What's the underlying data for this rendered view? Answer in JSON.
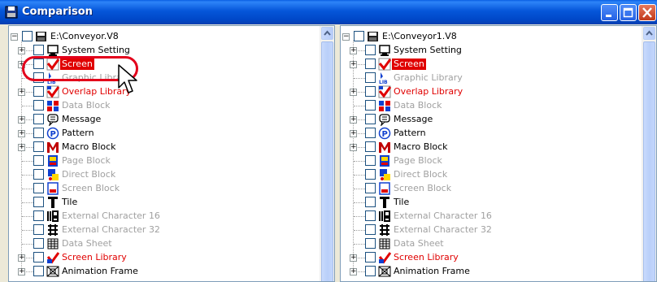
{
  "window": {
    "title": "Comparison"
  },
  "left": {
    "root": "E:\\Conveyor.V8",
    "items": [
      {
        "label": "System Setting",
        "style": "normal",
        "expand": true,
        "icon": "monitor-icon"
      },
      {
        "label": "Screen",
        "style": "sel",
        "expand": true,
        "icon": "screen-check-icon"
      },
      {
        "label": "Graphic Library",
        "style": "gray",
        "expand": false,
        "icon": "graphic-library-icon"
      },
      {
        "label": "Overlap Library",
        "style": "red",
        "expand": true,
        "icon": "overlap-library-icon"
      },
      {
        "label": "Data Block",
        "style": "gray",
        "expand": false,
        "icon": "data-block-icon"
      },
      {
        "label": "Message",
        "style": "normal",
        "expand": true,
        "icon": "message-icon"
      },
      {
        "label": "Pattern",
        "style": "normal",
        "expand": true,
        "icon": "pattern-icon"
      },
      {
        "label": "Macro Block",
        "style": "normal",
        "expand": true,
        "icon": "macro-block-icon"
      },
      {
        "label": "Page Block",
        "style": "gray",
        "expand": false,
        "icon": "page-block-icon"
      },
      {
        "label": "Direct Block",
        "style": "gray",
        "expand": false,
        "icon": "direct-block-icon"
      },
      {
        "label": "Screen Block",
        "style": "gray",
        "expand": false,
        "icon": "screen-block-icon"
      },
      {
        "label": "Tile",
        "style": "normal",
        "expand": false,
        "icon": "tile-icon"
      },
      {
        "label": "External Character 16",
        "style": "gray",
        "expand": false,
        "icon": "ext-char-16-icon"
      },
      {
        "label": "External Character 32",
        "style": "gray",
        "expand": false,
        "icon": "ext-char-32-icon"
      },
      {
        "label": "Data Sheet",
        "style": "gray",
        "expand": false,
        "icon": "data-sheet-icon"
      },
      {
        "label": "Screen Library",
        "style": "red",
        "expand": true,
        "icon": "screen-library-icon"
      },
      {
        "label": "Animation Frame",
        "style": "normal",
        "expand": true,
        "icon": "animation-frame-icon"
      }
    ]
  },
  "right": {
    "root": "E:\\Conveyor1.V8",
    "items": [
      {
        "label": "System Setting",
        "style": "normal",
        "expand": true,
        "icon": "monitor-icon"
      },
      {
        "label": "Screen",
        "style": "sel",
        "expand": true,
        "icon": "screen-check-icon"
      },
      {
        "label": "Graphic Library",
        "style": "gray",
        "expand": false,
        "icon": "graphic-library-icon"
      },
      {
        "label": "Overlap Library",
        "style": "red",
        "expand": true,
        "icon": "overlap-library-icon"
      },
      {
        "label": "Data Block",
        "style": "gray",
        "expand": false,
        "icon": "data-block-icon"
      },
      {
        "label": "Message",
        "style": "normal",
        "expand": true,
        "icon": "message-icon"
      },
      {
        "label": "Pattern",
        "style": "normal",
        "expand": true,
        "icon": "pattern-icon"
      },
      {
        "label": "Macro Block",
        "style": "normal",
        "expand": true,
        "icon": "macro-block-icon"
      },
      {
        "label": "Page Block",
        "style": "gray",
        "expand": false,
        "icon": "page-block-icon"
      },
      {
        "label": "Direct Block",
        "style": "gray",
        "expand": false,
        "icon": "direct-block-icon"
      },
      {
        "label": "Screen Block",
        "style": "gray",
        "expand": false,
        "icon": "screen-block-icon"
      },
      {
        "label": "Tile",
        "style": "normal",
        "expand": false,
        "icon": "tile-icon"
      },
      {
        "label": "External Character 16",
        "style": "gray",
        "expand": false,
        "icon": "ext-char-16-icon"
      },
      {
        "label": "External Character 32",
        "style": "gray",
        "expand": false,
        "icon": "ext-char-32-icon"
      },
      {
        "label": "Data Sheet",
        "style": "gray",
        "expand": false,
        "icon": "data-sheet-icon"
      },
      {
        "label": "Screen Library",
        "style": "red",
        "expand": true,
        "icon": "screen-library-icon"
      },
      {
        "label": "Animation Frame",
        "style": "normal",
        "expand": true,
        "icon": "animation-frame-icon"
      }
    ]
  },
  "colors": {
    "highlight": "#e00000",
    "disabled": "#a0a0a0",
    "titlebar": "#0556d9"
  }
}
